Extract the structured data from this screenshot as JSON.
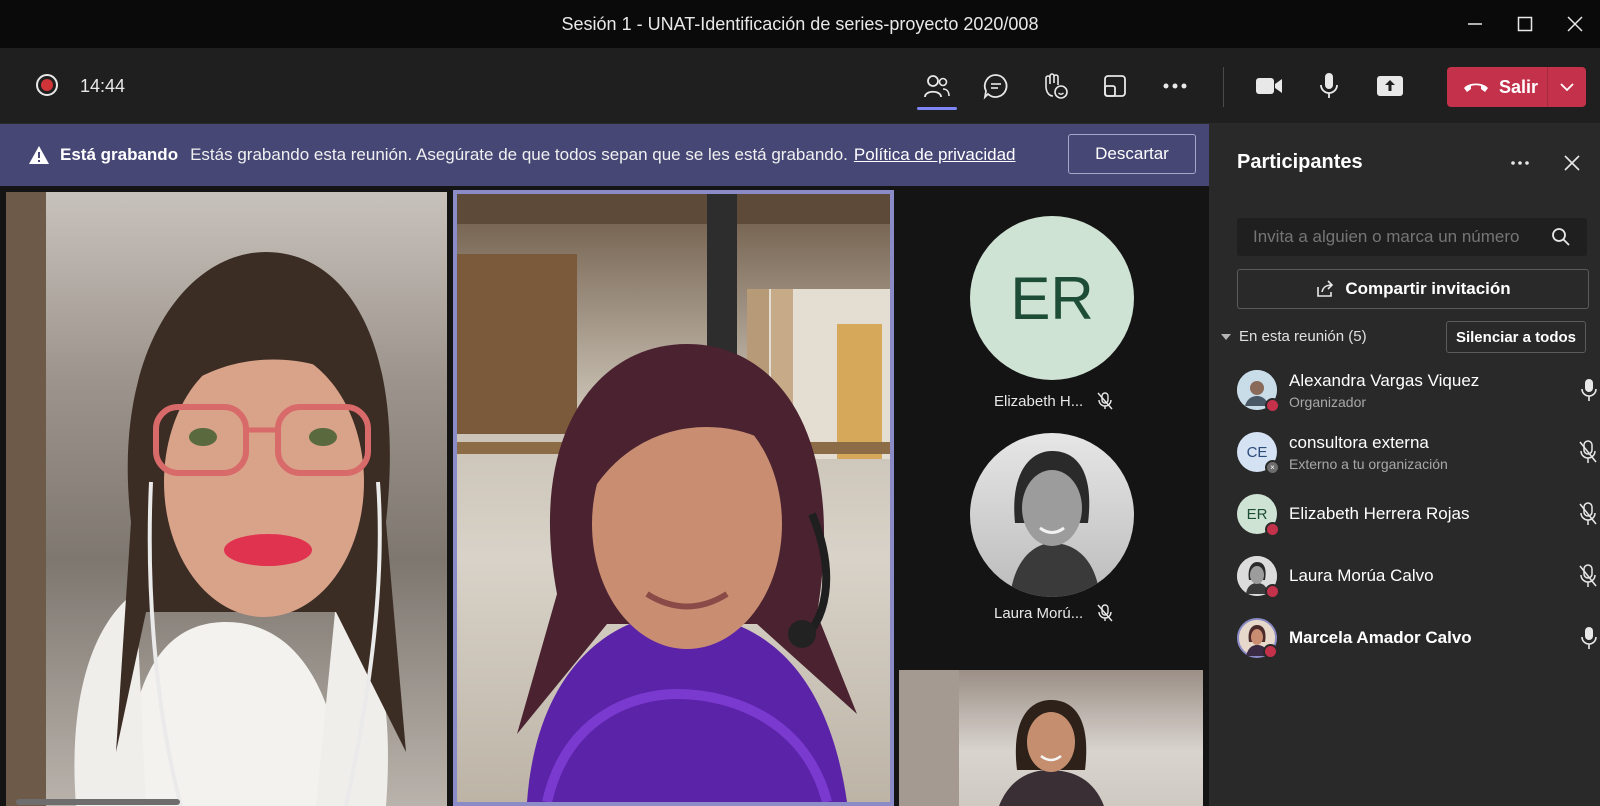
{
  "window": {
    "title": "Sesión 1 - UNAT-Identificación de series-proyecto 2020/008"
  },
  "toolbar": {
    "timer": "14:44",
    "leave_label": "Salir"
  },
  "banner": {
    "bold": "Está grabando",
    "text": "Estás grabando esta reunión. Asegúrate de que todos sepan que se les está grabando.",
    "link": "Política de privacidad",
    "dismiss": "Descartar"
  },
  "stage": {
    "side_tiles": [
      {
        "initials": "ER",
        "name": "Elizabeth H..."
      },
      {
        "name": "Laura Morú..."
      }
    ]
  },
  "panel": {
    "title": "Participantes",
    "invite_placeholder": "Invita a alguien o marca un número",
    "share_label": "Compartir invitación",
    "section_label": "En esta reunión (5)",
    "mute_all": "Silenciar a todos",
    "participants": [
      {
        "name": "Alexandra Vargas Viquez",
        "sub": "Organizador"
      },
      {
        "initials": "CE",
        "name": "consultora externa",
        "sub": "Externo a tu organización"
      },
      {
        "initials": "ER",
        "name": "Elizabeth Herrera Rojas"
      },
      {
        "name": "Laura Morúa Calvo"
      },
      {
        "name": "Marcela Amador Calvo"
      }
    ]
  },
  "colors": {
    "accent": "#7f85f5",
    "leave": "#c4314b",
    "banner": "#464775",
    "status_busy": "#c4314b"
  }
}
